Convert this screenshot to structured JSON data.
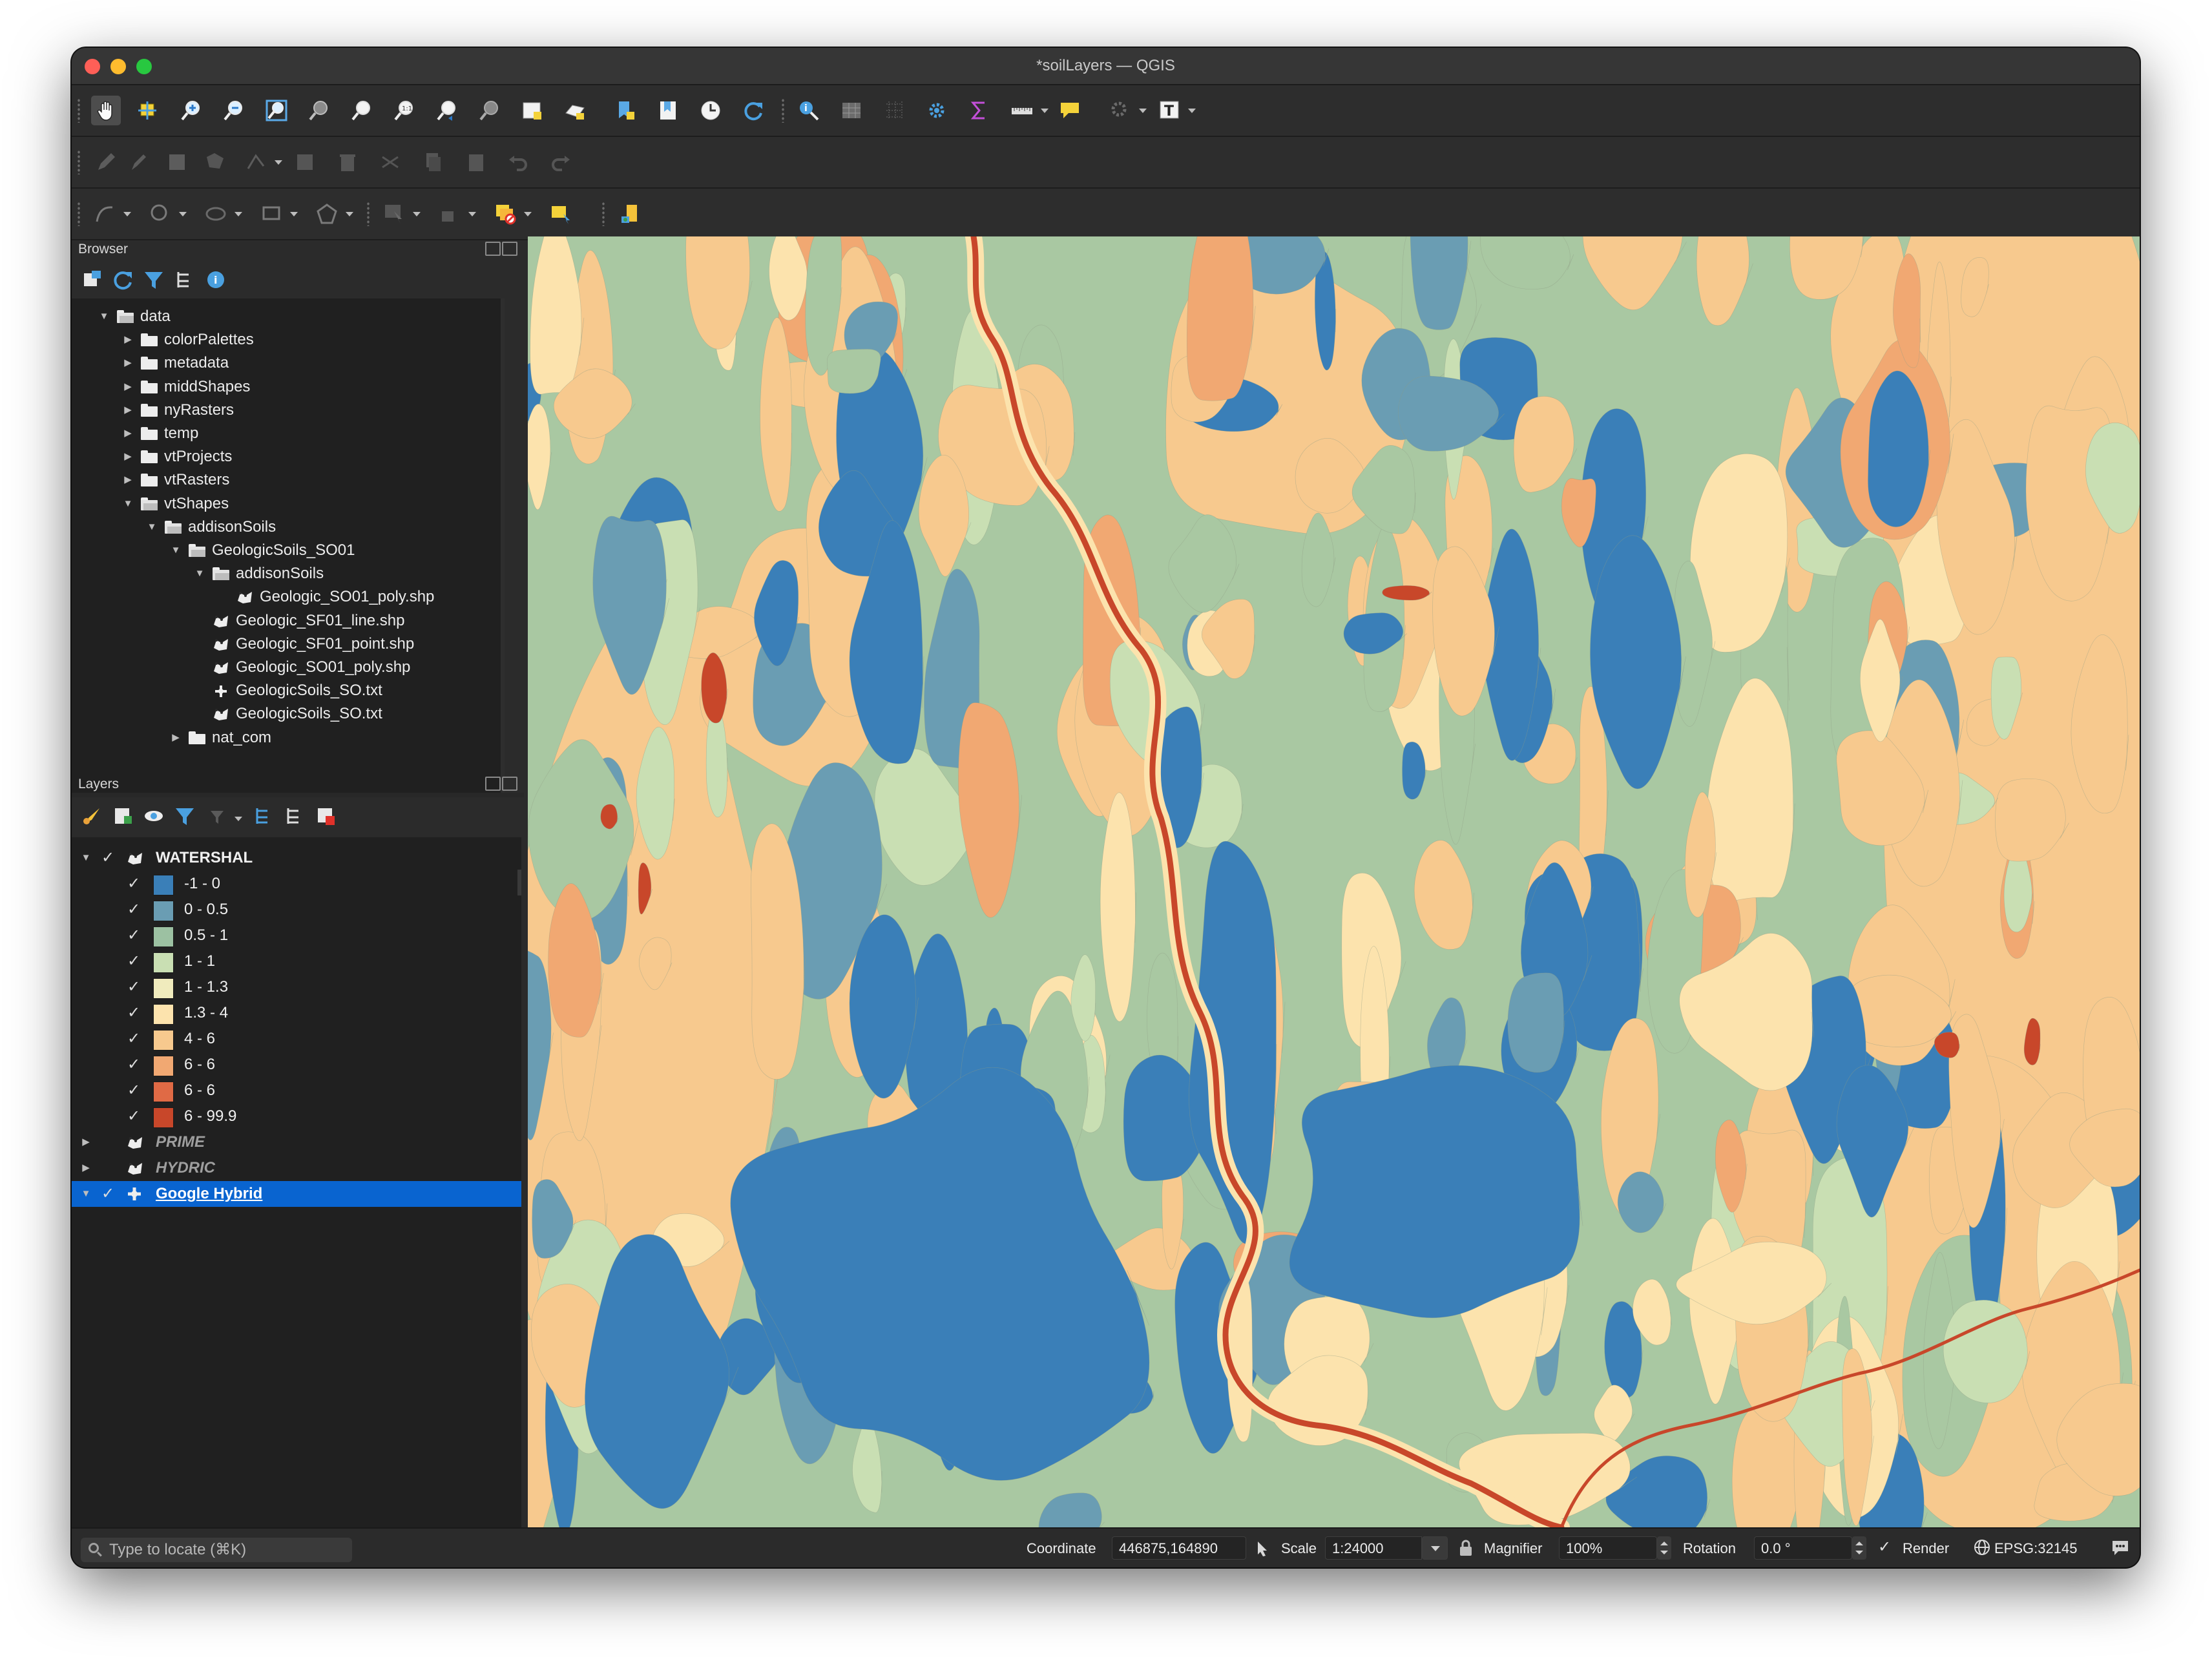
{
  "window": {
    "title": "*soilLayers — QGIS"
  },
  "browser": {
    "title": "Browser",
    "tree": [
      {
        "label": "data",
        "depth": 0,
        "type": "folder",
        "expanded": true
      },
      {
        "label": "colorPalettes",
        "depth": 1,
        "type": "folder",
        "expanded": false
      },
      {
        "label": "metadata",
        "depth": 1,
        "type": "folder",
        "expanded": false
      },
      {
        "label": "middShapes",
        "depth": 1,
        "type": "folder",
        "expanded": false
      },
      {
        "label": "nyRasters",
        "depth": 1,
        "type": "folder",
        "expanded": false
      },
      {
        "label": "temp",
        "depth": 1,
        "type": "folder",
        "expanded": false
      },
      {
        "label": "vtProjects",
        "depth": 1,
        "type": "folder",
        "expanded": false
      },
      {
        "label": "vtRasters",
        "depth": 1,
        "type": "folder",
        "expanded": false
      },
      {
        "label": "vtShapes",
        "depth": 1,
        "type": "folder",
        "expanded": true
      },
      {
        "label": "addisonSoils",
        "depth": 2,
        "type": "folder",
        "expanded": true
      },
      {
        "label": "GeologicSoils_SO01",
        "depth": 3,
        "type": "folder",
        "expanded": true
      },
      {
        "label": "addisonSoils",
        "depth": 4,
        "type": "folder",
        "expanded": true
      },
      {
        "label": "Geologic_SO01_poly.shp",
        "depth": 5,
        "type": "vector"
      },
      {
        "label": "Geologic_SF01_line.shp",
        "depth": 4,
        "type": "vector"
      },
      {
        "label": "Geologic_SF01_point.shp",
        "depth": 4,
        "type": "vector"
      },
      {
        "label": "Geologic_SO01_poly.shp",
        "depth": 4,
        "type": "vector"
      },
      {
        "label": "GeologicSoils_SO.txt",
        "depth": 4,
        "type": "table"
      },
      {
        "label": "GeologicSoils_SO.txt",
        "depth": 4,
        "type": "vector"
      },
      {
        "label": "nat_com",
        "depth": 3,
        "type": "folder",
        "expanded": false
      }
    ]
  },
  "layers": {
    "title": "Layers",
    "groups": [
      {
        "name": "WATERSHAL",
        "visible": true,
        "expanded": true,
        "style": "bold"
      },
      {
        "name": "PRIME",
        "visible": false,
        "expanded": false,
        "style": "italic"
      },
      {
        "name": "HYDRIC",
        "visible": false,
        "expanded": false,
        "style": "italic"
      },
      {
        "name": "Google Hybrid",
        "visible": true,
        "expanded": true,
        "style": "selected"
      }
    ],
    "legend": [
      {
        "label": "-1 - 0",
        "color": "#3a7fb8"
      },
      {
        "label": "0 - 0.5",
        "color": "#6a9db3"
      },
      {
        "label": "0.5 - 1",
        "color": "#9cc1a2"
      },
      {
        "label": "1 - 1",
        "color": "#c9dfb3"
      },
      {
        "label": "1 - 1.3",
        "color": "#f0ebbd"
      },
      {
        "label": "1.3 - 4",
        "color": "#fce3ad"
      },
      {
        "label": "4 - 6",
        "color": "#f7c98e"
      },
      {
        "label": "6 - 6",
        "color": "#f1a872"
      },
      {
        "label": "6 - 6",
        "color": "#e06a45"
      },
      {
        "label": "6 - 99.9",
        "color": "#c8472a"
      }
    ]
  },
  "map_colors": {
    "water": "#3a7fb8",
    "mid_blue": "#6a9db3",
    "green": "#a9c8a2",
    "light_green": "#c9dfb3",
    "cream": "#fce3ad",
    "tan": "#f7c98e",
    "orange": "#f1a872",
    "river": "#c8472a"
  },
  "status": {
    "locator_placeholder": "Type to locate (⌘K)",
    "coordinate_label": "Coordinate",
    "coordinate_value": "446875,164890",
    "scale_label": "Scale",
    "scale_value": "1:24000",
    "magnifier_label": "Magnifier",
    "magnifier_value": "100%",
    "rotation_label": "Rotation",
    "rotation_value": "0.0 °",
    "render_label": "Render",
    "crs_label": "EPSG:32145"
  }
}
